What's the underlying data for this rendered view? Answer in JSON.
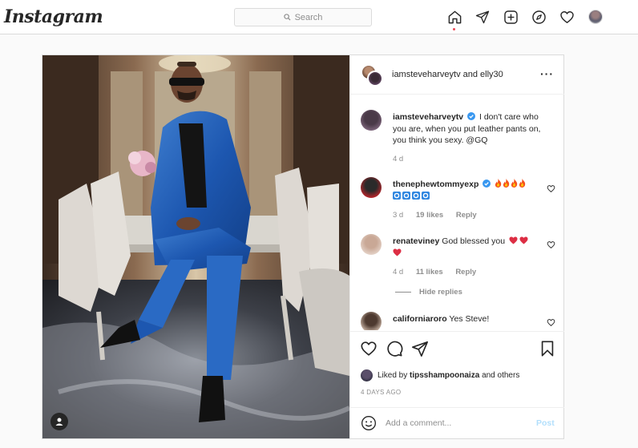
{
  "nav": {
    "logo": "Instagram",
    "search_placeholder": "Search"
  },
  "post": {
    "header_users": "iamsteveharveytv and elly30",
    "caption": {
      "user": "iamsteveharveytv",
      "text": "I don't care who you are, when you put leather pants on, you think you sexy. @GQ",
      "time": "4 d"
    },
    "comments": [
      {
        "user": "thenephewtommyexp",
        "text": "",
        "time": "3 d",
        "likes": "19 likes",
        "reply": "Reply"
      },
      {
        "user": "renateviney",
        "text": "God blessed you",
        "time": "4 d",
        "likes": "11 likes",
        "reply": "Reply"
      },
      {
        "user": "californiaroro",
        "text": "Yes Steve!"
      }
    ],
    "hide_replies": "Hide replies",
    "liked_by_prefix": "Liked by",
    "liked_by_user": "tipsshampoonaiza",
    "liked_by_suffix": "and others",
    "age": "4 DAYS AGO",
    "comment_placeholder": "Add a comment...",
    "post_label": "Post"
  },
  "colors": {
    "verified": "#3897f0",
    "heart_red": "#ed4956",
    "post_button": "#b2dffc"
  }
}
